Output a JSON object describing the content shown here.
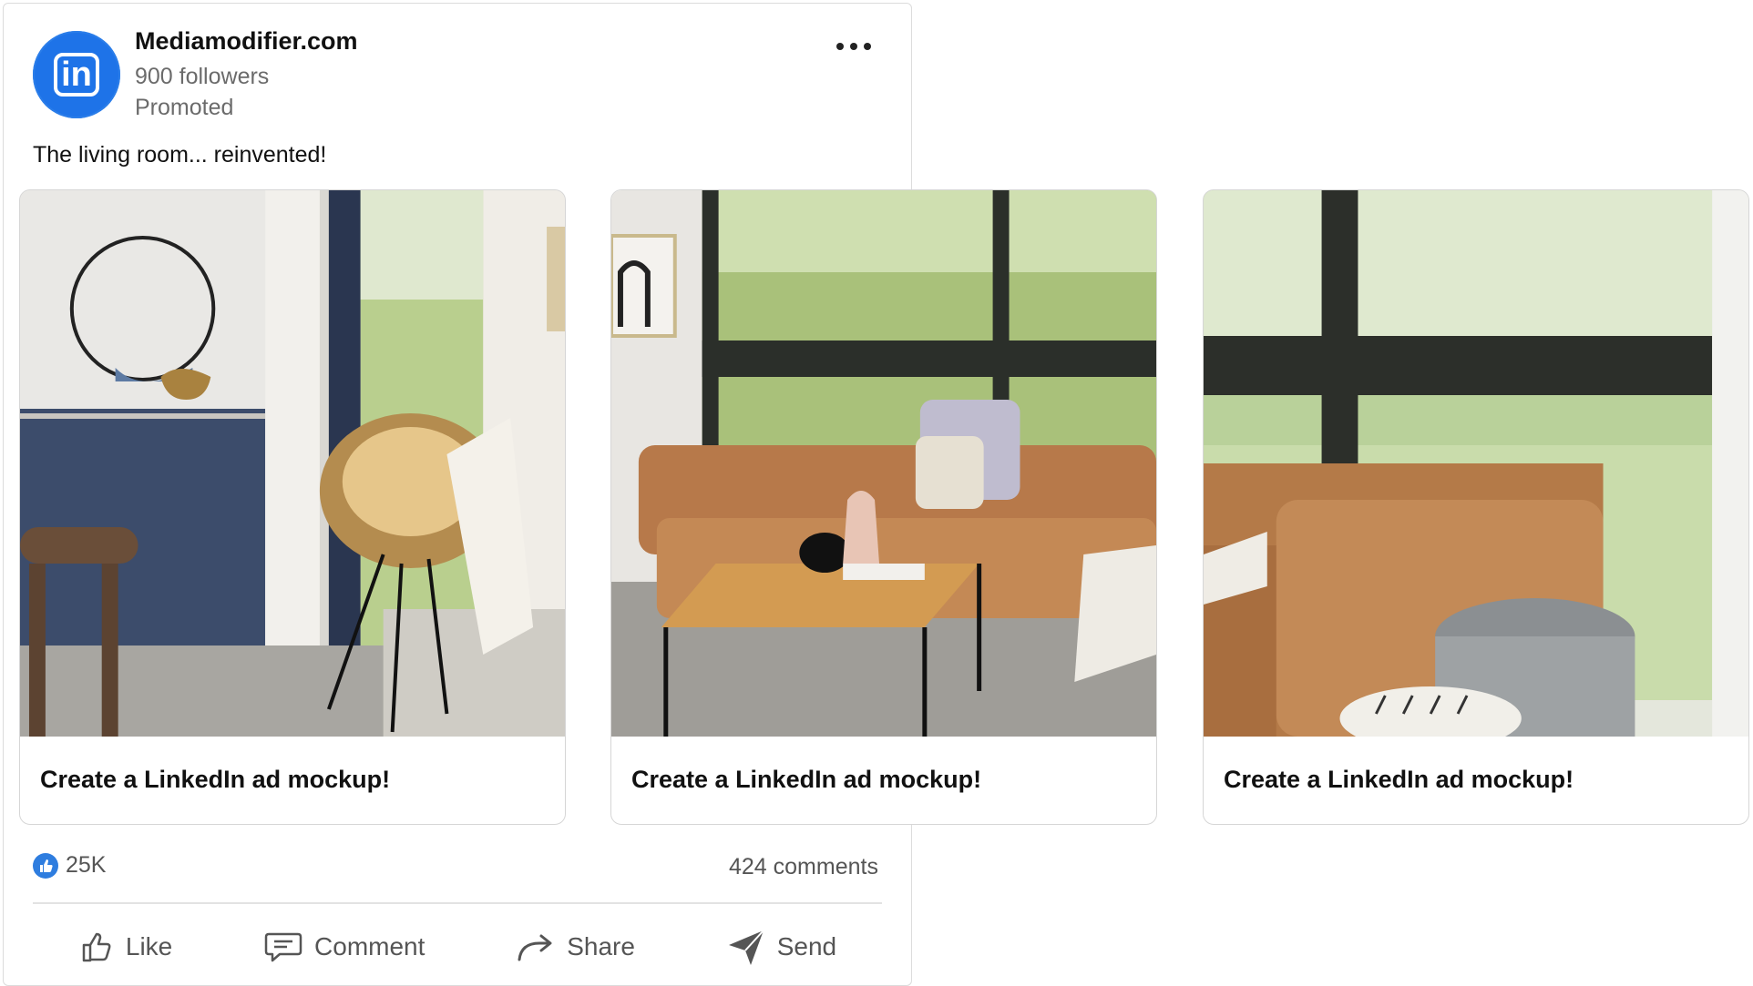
{
  "post": {
    "author": "Mediamodifier.com",
    "followers": "900 followers",
    "label": "Promoted",
    "caption": "The living room... reinvented!",
    "logo_text": "in"
  },
  "carousel": [
    {
      "cta": "Create a LinkedIn ad mockup!",
      "image": "living-room-rattan-chair-photo"
    },
    {
      "cta": "Create a LinkedIn ad mockup!",
      "image": "leather-sofa-coffee-table-photo"
    },
    {
      "cta": "Create a LinkedIn ad mockup!",
      "image": "leather-sofa-pouf-window-photo"
    }
  ],
  "stats": {
    "reactions": "25K",
    "comments": "424 comments"
  },
  "actions": [
    {
      "label": "Like",
      "icon": "thumbs-up-icon"
    },
    {
      "label": "Comment",
      "icon": "comment-icon"
    },
    {
      "label": "Share",
      "icon": "share-arrow-icon"
    },
    {
      "label": "Send",
      "icon": "send-icon"
    }
  ],
  "colors": {
    "brand": "#1e73e8",
    "text_muted": "#6b6b6b",
    "border": "#dcdcdc"
  }
}
